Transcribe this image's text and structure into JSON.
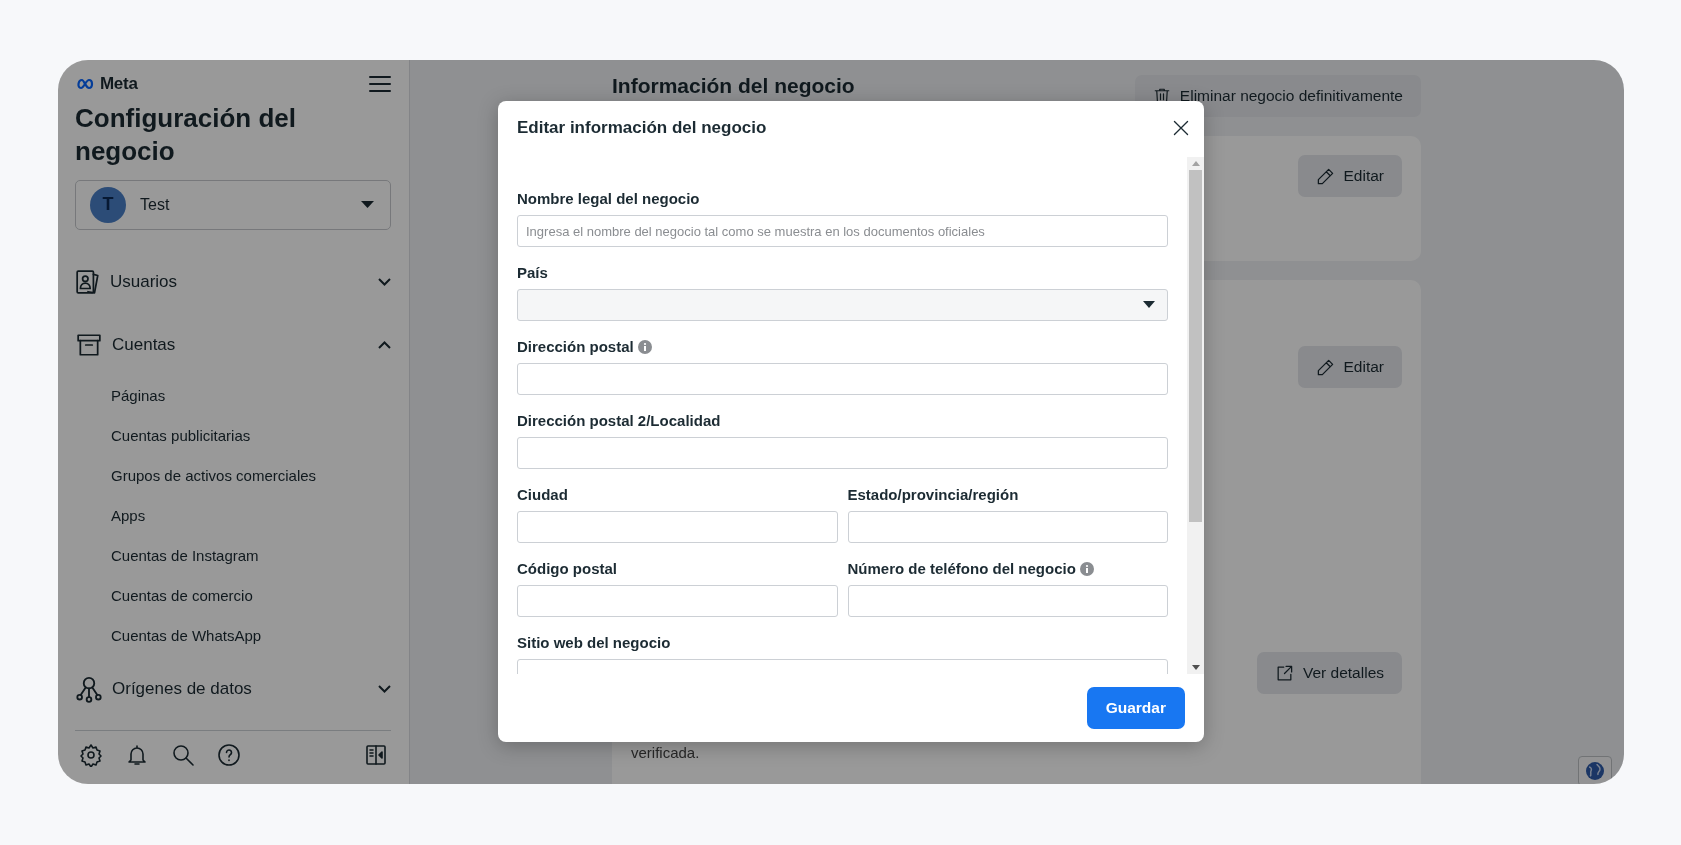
{
  "sidebar": {
    "logo": "Meta",
    "title": "Configuración del negocio",
    "account": {
      "initial": "T",
      "name": "Test"
    },
    "nav": [
      {
        "label": "Usuarios",
        "kind": "users",
        "expanded": false
      },
      {
        "label": "Cuentas",
        "kind": "box",
        "expanded": true,
        "children": [
          {
            "label": "Páginas"
          },
          {
            "label": "Cuentas publicitarias"
          },
          {
            "label": "Grupos de activos comerciales"
          },
          {
            "label": "Apps"
          },
          {
            "label": "Cuentas de Instagram"
          },
          {
            "label": "Cuentas de comercio"
          },
          {
            "label": "Cuentas de WhatsApp"
          }
        ]
      },
      {
        "label": "Orígenes de datos",
        "kind": "nodes",
        "expanded": false
      }
    ]
  },
  "page": {
    "title": "Información del negocio",
    "delete_button": "Eliminar negocio definitivamente",
    "cards": [
      {
        "actions": [
          {
            "kind": "edit",
            "label": "Editar"
          }
        ]
      },
      {
        "actions": [
          {
            "kind": "edit",
            "label": "Editar"
          },
          {
            "kind": "details",
            "label": "Ver detalles"
          }
        ],
        "text": "verificada."
      }
    ]
  },
  "modal": {
    "title": "Editar información del negocio",
    "rows": [
      [
        {
          "label": "Nombre legal del negocio",
          "kind": "text",
          "placeholder": "Ingresa el nombre del negocio tal como se muestra en los documentos oficiales"
        }
      ],
      [
        {
          "label": "País",
          "kind": "select"
        }
      ],
      [
        {
          "label": "Dirección postal",
          "kind": "text",
          "info": true
        }
      ],
      [
        {
          "label": "Dirección postal 2/Localidad",
          "kind": "text"
        }
      ],
      [
        {
          "label": "Ciudad",
          "kind": "text"
        },
        {
          "label": "Estado/provincia/región",
          "kind": "text"
        }
      ],
      [
        {
          "label": "Código postal",
          "kind": "text"
        },
        {
          "label": "Número de teléfono del negocio",
          "kind": "text",
          "info": true
        }
      ],
      [
        {
          "label": "Sitio web del negocio",
          "kind": "text"
        }
      ]
    ],
    "save_button": "Guardar"
  }
}
